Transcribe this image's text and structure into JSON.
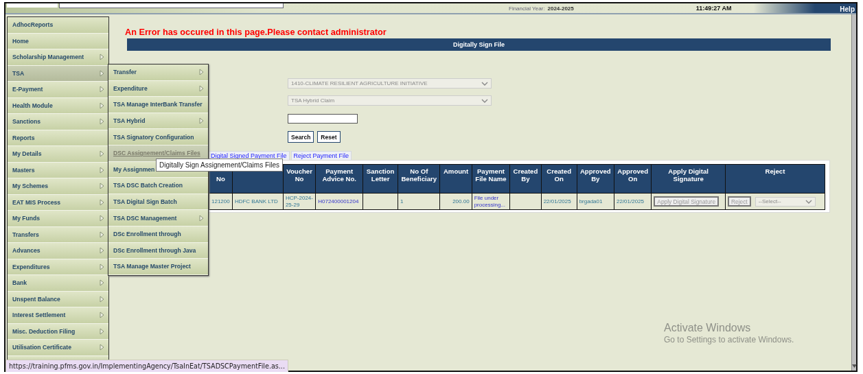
{
  "header": {
    "financial_year_label": "Financial Year:",
    "financial_year": "2024-2025",
    "time": "11:49:27 AM",
    "help": "Help"
  },
  "sidebar": {
    "items": [
      {
        "label": "AdhocReports",
        "has_submenu": false,
        "selected": false
      },
      {
        "label": "Home",
        "has_submenu": false,
        "selected": false
      },
      {
        "label": "Scholarship Management",
        "has_submenu": true,
        "selected": false
      },
      {
        "label": "TSA",
        "has_submenu": true,
        "selected": true
      },
      {
        "label": "E-Payment",
        "has_submenu": true,
        "selected": false
      },
      {
        "label": "Health Module",
        "has_submenu": true,
        "selected": false
      },
      {
        "label": "Sanctions",
        "has_submenu": true,
        "selected": false
      },
      {
        "label": "Reports",
        "has_submenu": false,
        "selected": false
      },
      {
        "label": "My Details",
        "has_submenu": true,
        "selected": false
      },
      {
        "label": "Masters",
        "has_submenu": true,
        "selected": false
      },
      {
        "label": "My Schemes",
        "has_submenu": true,
        "selected": false
      },
      {
        "label": "EAT MIS Process",
        "has_submenu": true,
        "selected": false
      },
      {
        "label": "My Funds",
        "has_submenu": true,
        "selected": false
      },
      {
        "label": "Transfers",
        "has_submenu": true,
        "selected": false
      },
      {
        "label": "Advances",
        "has_submenu": true,
        "selected": false
      },
      {
        "label": "Expenditures",
        "has_submenu": true,
        "selected": false
      },
      {
        "label": "Bank",
        "has_submenu": true,
        "selected": false
      },
      {
        "label": "Unspent Balance",
        "has_submenu": true,
        "selected": false
      },
      {
        "label": "Interest Settlement",
        "has_submenu": true,
        "selected": false
      },
      {
        "label": "Misc. Deduction Filing",
        "has_submenu": true,
        "selected": false
      },
      {
        "label": "Utilisation Certificate",
        "has_submenu": true,
        "selected": false
      }
    ]
  },
  "submenu": {
    "items": [
      {
        "label": "Transfer",
        "has_submenu": true,
        "selected": false
      },
      {
        "label": "Expenditure",
        "has_submenu": true,
        "selected": false
      },
      {
        "label": "TSA Manage InterBank Transfer",
        "has_submenu": false,
        "selected": false
      },
      {
        "label": "TSA Hybrid",
        "has_submenu": true,
        "selected": false
      },
      {
        "label": "TSA Signatory Configuration",
        "has_submenu": false,
        "selected": false
      },
      {
        "label": "DSC Assignement/Claims Files",
        "has_submenu": false,
        "selected": true
      },
      {
        "label": "My Assignmen",
        "has_submenu": false,
        "selected": false
      },
      {
        "label": "TSA DSC Batch Creation",
        "has_submenu": false,
        "selected": false
      },
      {
        "label": "TSA Digital Sign Batch",
        "has_submenu": false,
        "selected": false
      },
      {
        "label": "TSA DSC Management",
        "has_submenu": true,
        "selected": false
      },
      {
        "label": "DSc Enrollment through",
        "has_submenu": false,
        "selected": false
      },
      {
        "label": "DSc Enrollment through Java",
        "has_submenu": false,
        "selected": false
      },
      {
        "label": "TSA Manage Master Project",
        "has_submenu": false,
        "selected": false
      }
    ]
  },
  "tooltip": "Digitally Sign Assignement/Claims Files",
  "error_message": "An Error has occured in this page.Please contact administrator",
  "panel_title": "Digitally Sign File",
  "filters": [
    {
      "value": "1410-CLIMATE RESILIENT AGRICULTURE INITIATIVE",
      "disabled": true
    },
    {
      "value": "TSA Hybrid Claim",
      "disabled": true
    }
  ],
  "buttons": [
    "Search",
    "Reset"
  ],
  "tabs": [
    {
      "label": "Digital Signed Payment File",
      "selected": false
    },
    {
      "label": "Reject Payment File",
      "selected": false
    }
  ],
  "table": {
    "columns": [
      {
        "label": "No",
        "first_line_hidden": true
      },
      {},
      {
        "label": "Voucher No"
      },
      {
        "label": "Payment Advice No."
      },
      {
        "label": "Sanction Letter"
      },
      {
        "label": "No Of Beneficiary"
      },
      {
        "label": "Amount"
      },
      {
        "label": "Payment File Name"
      },
      {
        "label": "Created By"
      },
      {
        "label": "Created On"
      },
      {
        "label": "Approved By"
      },
      {
        "label": "Approved On"
      },
      {
        "label": "Apply Digital Signature"
      },
      {
        "label": "Reject"
      }
    ],
    "rows": [
      {
        "cells": [
          {
            "kind": "text",
            "text": "121200"
          },
          {
            "kind": "text",
            "text": "HDFC BANK LTD"
          },
          {
            "kind": "text",
            "text": "HCP-2024-25-29"
          },
          {
            "kind": "link",
            "text": "H072400001204"
          },
          {
            "kind": "empty"
          },
          {
            "kind": "text",
            "text": "1"
          },
          {
            "kind": "number",
            "text": "200.00"
          },
          {
            "kind": "link",
            "text": "File under processing..."
          },
          {
            "kind": "empty"
          },
          {
            "kind": "text",
            "text": "22/01/2025"
          },
          {
            "kind": "text",
            "text": "brgada01"
          },
          {
            "kind": "text",
            "text": "22/01/2025"
          },
          {
            "kind": "button",
            "text": "Apply Digital Signature",
            "disabled": true
          },
          {
            "kind": "reject",
            "text": "Reject",
            "select": "--Select--",
            "disabled": true
          }
        ]
      }
    ]
  },
  "status_url": "https://training.pfms.gov.in/ImplementingAgency/TsaInEat/TSADSCPaymentFile.as...",
  "watermark": {
    "title": "Activate Windows",
    "subtitle": "Go to Settings to activate Windows."
  }
}
